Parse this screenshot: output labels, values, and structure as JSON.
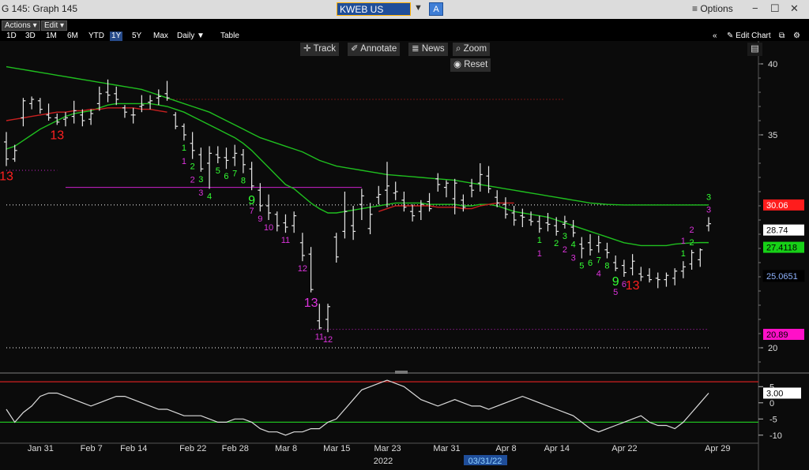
{
  "window": {
    "title": "G 145: Graph 145",
    "security": "KWEB US Equity",
    "security_type_badge": "A",
    "options_label": "Options",
    "icons": [
      "hamburger-icon",
      "minimize-icon",
      "maximize-icon",
      "close-icon"
    ]
  },
  "toolbar": {
    "actions_label": "Actions",
    "edit_label": "Edit",
    "periods": [
      "1D",
      "3D",
      "1M",
      "6M",
      "YTD",
      "1Y",
      "5Y",
      "Max"
    ],
    "active_period": "1Y",
    "frequency": "Daily",
    "table_label": "Table",
    "edit_chart_label": "Edit Chart",
    "track_label": "Track",
    "annotate_label": "Annotate",
    "news_label": "News",
    "zoom_label": "Zoom",
    "reset_label": "Reset"
  },
  "chart_data": {
    "type": "bar",
    "title": "",
    "y_ticks": [
      40,
      35,
      20
    ],
    "y_range": [
      18.5,
      42
    ],
    "x_ticks": [
      "Jan 31",
      "Feb 7",
      "Feb 14",
      "Feb 22",
      "Feb 28",
      "Mar 8",
      "Mar 15",
      "Mar 23",
      "Mar 31",
      "Apr 8",
      "Apr 14",
      "Apr 22",
      "Apr 29"
    ],
    "x_year_label": "2022",
    "cursor_date": "03/31/22",
    "price_labels": [
      {
        "value": "30.06",
        "color": "#ff1c1c",
        "text_color": "#ffffff"
      },
      {
        "value": "28.74",
        "color": "#ffffff",
        "text_color": "#000000"
      },
      {
        "value": "27.4118",
        "color": "#17d117",
        "text_color": "#000000"
      },
      {
        "value": "25.0651",
        "color": "#000000",
        "text_color": "#8fb3ff"
      },
      {
        "value": "20.89",
        "color": "#ff10c8",
        "text_color": "#000000"
      }
    ],
    "ohlc": [
      [
        34.5,
        35.2,
        32.8,
        33.3
      ],
      [
        33.3,
        34.3,
        33.1,
        33.9
      ],
      [
        36.2,
        37.6,
        35.6,
        37.4
      ],
      [
        37.2,
        37.7,
        36.8,
        37.5
      ],
      [
        37.4,
        37.6,
        36.5,
        36.8
      ],
      [
        36.4,
        37.2,
        36.0,
        36.2
      ],
      [
        36.2,
        36.5,
        35.7,
        35.9
      ],
      [
        36.1,
        36.6,
        35.6,
        36.2
      ],
      [
        36.3,
        37.4,
        35.8,
        36.7
      ],
      [
        36.4,
        36.8,
        35.6,
        36.0
      ],
      [
        36.1,
        36.8,
        35.7,
        36.5
      ],
      [
        37.2,
        38.4,
        36.7,
        37.9
      ],
      [
        38.0,
        38.9,
        37.3,
        37.8
      ],
      [
        37.9,
        38.4,
        37.1,
        37.5
      ],
      [
        36.9,
        37.1,
        36.2,
        36.6
      ],
      [
        36.4,
        36.9,
        35.8,
        36.4
      ],
      [
        37.0,
        37.8,
        36.6,
        37.1
      ],
      [
        37.3,
        37.8,
        36.8,
        37.4
      ],
      [
        37.6,
        38.2,
        37.1,
        37.7
      ],
      [
        37.9,
        38.8,
        37.4,
        37.6
      ],
      [
        36.4,
        36.6,
        35.4,
        35.6
      ],
      [
        35.6,
        35.8,
        34.6,
        35.0
      ],
      [
        34.4,
        35.2,
        33.3,
        33.9
      ],
      [
        33.6,
        34.1,
        32.4,
        32.6
      ],
      [
        33.0,
        34.2,
        31.2,
        33.7
      ],
      [
        33.6,
        34.2,
        33.0,
        33.4
      ],
      [
        33.4,
        34.1,
        32.6,
        33.2
      ],
      [
        33.4,
        34.3,
        32.8,
        33.7
      ],
      [
        33.6,
        34.0,
        32.3,
        32.9
      ],
      [
        32.6,
        33.1,
        31.1,
        31.4
      ],
      [
        31.1,
        31.6,
        29.6,
        30.0
      ],
      [
        30.0,
        30.8,
        29.0,
        29.5
      ],
      [
        29.4,
        29.6,
        28.2,
        28.6
      ],
      [
        28.8,
        29.4,
        28.1,
        28.5
      ],
      [
        28.6,
        29.6,
        28.1,
        29.3
      ],
      [
        27.4,
        28.1,
        26.1,
        26.5
      ],
      [
        26.6,
        27.1,
        23.9,
        24.1
      ],
      [
        21.9,
        23.1,
        21.3,
        21.4
      ],
      [
        22.0,
        23.1,
        21.1,
        22.9
      ],
      [
        27.8,
        28.1,
        26.0,
        26.4
      ],
      [
        28.2,
        31.0,
        27.7,
        29.6
      ],
      [
        28.6,
        30.0,
        27.6,
        28.2
      ],
      [
        30.1,
        31.2,
        29.0,
        30.7
      ],
      [
        28.4,
        30.2,
        28.0,
        29.4
      ],
      [
        30.6,
        31.4,
        30.1,
        30.8
      ],
      [
        31.1,
        33.1,
        29.9,
        31.4
      ],
      [
        30.9,
        31.7,
        30.4,
        31.0
      ],
      [
        30.4,
        31.0,
        29.6,
        29.9
      ],
      [
        29.6,
        30.1,
        28.9,
        29.3
      ],
      [
        29.6,
        30.4,
        29.0,
        30.1
      ],
      [
        30.3,
        30.9,
        29.6,
        29.8
      ],
      [
        31.9,
        32.3,
        31.0,
        31.5
      ],
      [
        31.3,
        31.8,
        30.6,
        31.6
      ],
      [
        30.5,
        31.9,
        29.4,
        31.6
      ],
      [
        30.4,
        30.8,
        29.6,
        29.9
      ],
      [
        31.4,
        31.9,
        30.6,
        31.1
      ],
      [
        31.6,
        33.0,
        31.0,
        32.2
      ],
      [
        32.1,
        32.8,
        30.9,
        31.2
      ],
      [
        30.6,
        31.1,
        29.9,
        30.2
      ],
      [
        30.1,
        30.6,
        29.1,
        29.4
      ],
      [
        29.5,
        30.0,
        28.6,
        29.0
      ],
      [
        29.3,
        29.8,
        28.5,
        29.2
      ],
      [
        29.0,
        29.6,
        28.6,
        28.9
      ],
      [
        28.9,
        29.3,
        28.1,
        28.4
      ],
      [
        28.8,
        29.5,
        28.2,
        28.7
      ],
      [
        28.6,
        29.2,
        27.9,
        28.2
      ],
      [
        28.7,
        29.3,
        28.4,
        28.9
      ],
      [
        28.5,
        29.0,
        27.8,
        28.1
      ],
      [
        27.3,
        27.8,
        26.3,
        27.0
      ],
      [
        27.4,
        28.0,
        26.5,
        26.9
      ],
      [
        27.2,
        27.9,
        26.7,
        27.4
      ],
      [
        26.9,
        27.4,
        26.3,
        26.7
      ],
      [
        26.0,
        26.5,
        25.4,
        25.6
      ],
      [
        25.8,
        26.2,
        25.0,
        25.3
      ],
      [
        25.6,
        26.6,
        25.1,
        26.1
      ],
      [
        25.2,
        25.7,
        24.7,
        25.0
      ],
      [
        25.1,
        25.6,
        24.6,
        24.8
      ],
      [
        24.9,
        25.3,
        24.2,
        24.8
      ],
      [
        24.8,
        25.3,
        24.3,
        25.1
      ],
      [
        24.9,
        25.6,
        24.4,
        25.4
      ],
      [
        25.4,
        26.1,
        24.9,
        25.7
      ],
      [
        25.9,
        26.9,
        25.5,
        26.7
      ],
      [
        26.2,
        27.0,
        25.7,
        26.9
      ],
      [
        28.6,
        29.2,
        28.2,
        28.74
      ]
    ],
    "ma_green_fast": [
      34.0,
      34.2,
      34.6,
      35.0,
      35.4,
      35.7,
      36.0,
      36.3,
      36.5,
      36.6,
      36.7,
      36.9,
      37.1,
      37.2,
      37.2,
      37.2,
      37.2,
      37.2,
      37.1,
      37.0,
      36.8,
      36.6,
      36.3,
      36.0,
      35.7,
      35.4,
      35.1,
      34.8,
      34.4,
      33.9,
      33.3,
      32.7,
      32.1,
      31.5,
      31.2,
      30.7,
      30.2,
      29.8,
      29.5,
      29.5,
      29.6,
      29.7,
      29.8,
      29.9,
      30.0,
      30.1,
      30.2,
      30.2,
      30.2,
      30.2,
      30.1,
      30.1,
      30.1,
      30.1,
      30.0,
      30.0,
      30.1,
      30.1,
      30.0,
      29.8,
      29.6,
      29.5,
      29.4,
      29.3,
      29.2,
      29.0,
      28.8,
      28.6,
      28.4,
      28.2,
      28.0,
      27.8,
      27.6,
      27.4,
      27.3,
      27.2,
      27.2,
      27.2,
      27.2,
      27.3,
      27.35,
      27.39,
      27.41,
      27.41
    ],
    "ma_green_slow": [
      39.8,
      39.7,
      39.6,
      39.5,
      39.4,
      39.3,
      39.2,
      39.1,
      39.0,
      38.9,
      38.8,
      38.7,
      38.6,
      38.5,
      38.4,
      38.3,
      38.2,
      38.0,
      37.8,
      37.6,
      37.4,
      37.2,
      37.0,
      36.8,
      36.6,
      36.3,
      36.0,
      35.7,
      35.4,
      35.1,
      34.8,
      34.6,
      34.4,
      34.2,
      34.0,
      33.8,
      33.5,
      33.2,
      33.0,
      32.8,
      32.7,
      32.6,
      32.5,
      32.4,
      32.3,
      32.2,
      32.15,
      32.1,
      32.05,
      32.0,
      31.95,
      31.9,
      31.85,
      31.8,
      31.7,
      31.6,
      31.5,
      31.4,
      31.3,
      31.2,
      31.1,
      31.0,
      30.9,
      30.8,
      30.7,
      30.6,
      30.5,
      30.4,
      30.3,
      30.2,
      30.15,
      30.1,
      30.08,
      30.06,
      30.06,
      30.06,
      30.06,
      30.06,
      30.06,
      30.06,
      30.06,
      30.06,
      30.06,
      30.06
    ],
    "ma_red": [
      36.0,
      36.1,
      36.2,
      36.3,
      36.4,
      36.5,
      36.6,
      36.6,
      36.7,
      36.7,
      36.8,
      36.8,
      36.9,
      36.9,
      36.9,
      36.9,
      36.8,
      36.8,
      36.7,
      36.6,
      null,
      null,
      null,
      null,
      null,
      null,
      null,
      null,
      null,
      null,
      null,
      null,
      null,
      null,
      null,
      null,
      null,
      null,
      null,
      null,
      null,
      null,
      null,
      null,
      29.6,
      29.8,
      30.0,
      30.0,
      30.0,
      30.0,
      30.0,
      29.9,
      29.9,
      29.9,
      29.8,
      29.8,
      30.0,
      30.1,
      30.2,
      30.2,
      30.2,
      null,
      null,
      null,
      null,
      null,
      null,
      null,
      null,
      null,
      null,
      null,
      null,
      null,
      null,
      null,
      null,
      null,
      null,
      null,
      null,
      null,
      null,
      null
    ],
    "h_lines": [
      {
        "value": 37.5,
        "color": "#d02020",
        "style": "dotted",
        "from": 19,
        "to": 66
      },
      {
        "value": 32.5,
        "color": "#cc20cc",
        "style": "dotted",
        "from": 0,
        "to": 6
      },
      {
        "value": 31.3,
        "color": "#cc20cc",
        "style": "solid",
        "from": 7,
        "to": 42
      },
      {
        "value": 30.06,
        "color": "#ffffff",
        "style": "dotted",
        "from": 0,
        "to": 83
      },
      {
        "value": 21.3,
        "color": "#cc20cc",
        "style": "dotted",
        "from": 36,
        "to": 83
      },
      {
        "value": 20.0,
        "color": "#ffffff",
        "style": "dotted",
        "from": 0,
        "to": 83
      }
    ],
    "td_counts": [
      {
        "i": 0,
        "label": "13",
        "color": "#ff2020",
        "big": true,
        "pos": "below"
      },
      {
        "i": 6,
        "label": "13",
        "color": "#ff2020",
        "big": true,
        "pos": "below"
      },
      {
        "i": 21,
        "label": "1",
        "color": "#33ff33",
        "pos": "below"
      },
      {
        "i": 22,
        "label": "2",
        "color": "#33ff33",
        "pos": "below"
      },
      {
        "i": 23,
        "label": "3",
        "color": "#33ff33",
        "pos": "below"
      },
      {
        "i": 24,
        "label": "4",
        "color": "#33ff33",
        "pos": "below"
      },
      {
        "i": 25,
        "label": "5",
        "color": "#33ff33",
        "pos": "below"
      },
      {
        "i": 26,
        "label": "6",
        "color": "#33ff33",
        "pos": "below"
      },
      {
        "i": 27,
        "label": "7",
        "color": "#33ff33",
        "pos": "below"
      },
      {
        "i": 28,
        "label": "8",
        "color": "#33ff33",
        "pos": "below"
      },
      {
        "i": 29,
        "label": "9",
        "color": "#33ff33",
        "big": true,
        "pos": "below"
      },
      {
        "i": 21,
        "label": "1",
        "color": "#dd33dd",
        "pos": "below2"
      },
      {
        "i": 22,
        "label": "2",
        "color": "#dd33dd",
        "pos": "below2"
      },
      {
        "i": 23,
        "label": "3",
        "color": "#dd33dd",
        "pos": "below2"
      },
      {
        "i": 29,
        "label": "7",
        "color": "#dd33dd",
        "pos": "below2"
      },
      {
        "i": 30,
        "label": "9",
        "color": "#dd33dd",
        "pos": "below"
      },
      {
        "i": 31,
        "label": "10",
        "color": "#dd33dd",
        "pos": "below"
      },
      {
        "i": 33,
        "label": "11",
        "color": "#dd33dd",
        "pos": "below"
      },
      {
        "i": 35,
        "label": "12",
        "color": "#dd33dd",
        "pos": "below"
      },
      {
        "i": 36,
        "label": "13",
        "color": "#dd33dd",
        "big": true,
        "pos": "below"
      },
      {
        "i": 37,
        "label": "11",
        "color": "#dd33dd",
        "pos": "below"
      },
      {
        "i": 38,
        "label": "12",
        "color": "#dd33dd",
        "pos": "below"
      },
      {
        "i": 63,
        "label": "1",
        "color": "#33ff33",
        "pos": "below"
      },
      {
        "i": 65,
        "label": "2",
        "color": "#33ff33",
        "pos": "below"
      },
      {
        "i": 66,
        "label": "3",
        "color": "#33ff33",
        "pos": "below"
      },
      {
        "i": 67,
        "label": "4",
        "color": "#33ff33",
        "pos": "below"
      },
      {
        "i": 68,
        "label": "5",
        "color": "#33ff33",
        "pos": "below"
      },
      {
        "i": 69,
        "label": "6",
        "color": "#33ff33",
        "pos": "below"
      },
      {
        "i": 70,
        "label": "7",
        "color": "#33ff33",
        "pos": "below"
      },
      {
        "i": 71,
        "label": "8",
        "color": "#33ff33",
        "pos": "below"
      },
      {
        "i": 72,
        "label": "9",
        "color": "#33ff33",
        "big": true,
        "pos": "below"
      },
      {
        "i": 63,
        "label": "1",
        "color": "#dd33dd",
        "pos": "below2"
      },
      {
        "i": 66,
        "label": "2",
        "color": "#dd33dd",
        "pos": "below2"
      },
      {
        "i": 67,
        "label": "3",
        "color": "#dd33dd",
        "pos": "below2"
      },
      {
        "i": 70,
        "label": "4",
        "color": "#dd33dd",
        "pos": "below2"
      },
      {
        "i": 72,
        "label": "5",
        "color": "#dd33dd",
        "pos": "below2"
      },
      {
        "i": 73,
        "label": "6",
        "color": "#dd33dd",
        "pos": "below"
      },
      {
        "i": 74,
        "label": "13",
        "color": "#ff2020",
        "big": true,
        "pos": "below"
      },
      {
        "i": 80,
        "label": "1",
        "color": "#33ff33",
        "pos": "above"
      },
      {
        "i": 81,
        "label": "2",
        "color": "#33ff33",
        "pos": "above"
      },
      {
        "i": 83,
        "label": "3",
        "color": "#33ff33",
        "pos": "above2"
      },
      {
        "i": 80,
        "label": "1",
        "color": "#dd33dd",
        "pos": "above2"
      },
      {
        "i": 81,
        "label": "2",
        "color": "#dd33dd",
        "pos": "above2"
      },
      {
        "i": 83,
        "label": "3",
        "color": "#dd33dd",
        "pos": "above"
      }
    ],
    "oscillator": {
      "y_ticks": [
        5,
        0,
        -5,
        -10
      ],
      "y_range": [
        -12,
        8
      ],
      "last_value": "3.00",
      "upper_line": 6.5,
      "lower_line": -6,
      "values": [
        -2,
        -6,
        -3,
        -1,
        2,
        3,
        3,
        2,
        1,
        0,
        -1,
        0,
        1,
        2,
        2,
        1,
        0,
        -1,
        -2,
        -2,
        -3,
        -4,
        -4,
        -4,
        -5,
        -6,
        -6,
        -5,
        -5,
        -6,
        -8,
        -9,
        -9,
        -10,
        -9,
        -9,
        -8,
        -8,
        -6,
        -5,
        -2,
        1,
        4,
        5,
        6,
        7,
        6,
        5,
        3,
        1,
        0,
        -1,
        0,
        1,
        0,
        -1,
        -1,
        -2,
        -1,
        0,
        1,
        2,
        1,
        0,
        -1,
        -2,
        -3,
        -4,
        -6,
        -8,
        -9,
        -8,
        -7,
        -6,
        -5,
        -4,
        -6,
        -7,
        -7,
        -8,
        -6,
        -3,
        0,
        3
      ]
    }
  }
}
